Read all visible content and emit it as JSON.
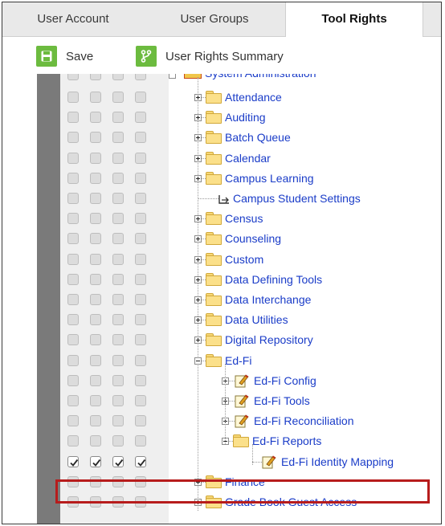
{
  "tabs": [
    {
      "label": "User Account",
      "active": false
    },
    {
      "label": "User Groups",
      "active": false
    },
    {
      "label": "Tool Rights",
      "active": true
    }
  ],
  "toolbar": {
    "save_label": "Save",
    "save_icon": "save-icon",
    "summary_label": "User Rights Summary",
    "summary_icon": "branch-icon",
    "accent_color": "#6cbb3f"
  },
  "tree": {
    "partial_label": "System Administration",
    "rows": [
      {
        "label": "Attendance",
        "type": "folder",
        "expander": "plus",
        "checks": [
          false,
          false,
          false,
          false
        ]
      },
      {
        "label": "Auditing",
        "type": "folder",
        "expander": "plus",
        "checks": [
          false,
          false,
          false,
          false
        ]
      },
      {
        "label": "Batch Queue",
        "type": "folder",
        "expander": "plus",
        "checks": [
          false,
          false,
          false,
          false
        ]
      },
      {
        "label": "Calendar",
        "type": "folder",
        "expander": "plus",
        "checks": [
          false,
          false,
          false,
          false
        ]
      },
      {
        "label": "Campus Learning",
        "type": "folder",
        "expander": "plus",
        "checks": [
          false,
          false,
          false,
          false
        ]
      },
      {
        "label": "Campus Student Settings",
        "type": "link",
        "expander": "none",
        "checks": [
          false,
          false,
          false,
          false
        ]
      },
      {
        "label": "Census",
        "type": "folder",
        "expander": "plus",
        "checks": [
          false,
          false,
          false,
          false
        ]
      },
      {
        "label": "Counseling",
        "type": "folder",
        "expander": "plus",
        "checks": [
          false,
          false,
          false,
          false
        ]
      },
      {
        "label": "Custom",
        "type": "folder",
        "expander": "plus",
        "checks": [
          false,
          false,
          false,
          false
        ]
      },
      {
        "label": "Data Defining Tools",
        "type": "folder",
        "expander": "plus",
        "checks": [
          false,
          false,
          false,
          false
        ]
      },
      {
        "label": "Data Interchange",
        "type": "folder",
        "expander": "plus",
        "checks": [
          false,
          false,
          false,
          false
        ]
      },
      {
        "label": "Data Utilities",
        "type": "folder",
        "expander": "plus",
        "checks": [
          false,
          false,
          false,
          false
        ]
      },
      {
        "label": "Digital Repository",
        "type": "folder",
        "expander": "plus",
        "checks": [
          false,
          false,
          false,
          false
        ]
      },
      {
        "label": "Ed-Fi",
        "type": "folder",
        "expander": "minus",
        "checks": [
          false,
          false,
          false,
          false
        ]
      },
      {
        "label": "Ed-Fi Config",
        "type": "tool",
        "expander": "plus",
        "checks": [
          false,
          false,
          false,
          false
        ]
      },
      {
        "label": "Ed-Fi Tools",
        "type": "tool",
        "expander": "plus",
        "checks": [
          false,
          false,
          false,
          false
        ]
      },
      {
        "label": "Ed-Fi Reconciliation",
        "type": "tool",
        "expander": "plus",
        "checks": [
          false,
          false,
          false,
          false
        ]
      },
      {
        "label": "Ed-Fi Reports",
        "type": "folder",
        "expander": "minus",
        "checks": [
          false,
          false,
          false,
          false
        ]
      },
      {
        "label": "Ed-Fi Identity Mapping",
        "type": "tool",
        "expander": "none",
        "checks": [
          true,
          true,
          true,
          true
        ],
        "highlighted": true
      },
      {
        "label": "Finance",
        "type": "folder",
        "expander": "plus",
        "checks": [
          false,
          false,
          false,
          false
        ]
      },
      {
        "label": "Grade Book Guest Access",
        "type": "folder",
        "expander": "plus",
        "checks": [
          false,
          false,
          false,
          false
        ]
      }
    ]
  },
  "colors": {
    "link": "#1a3cc8",
    "highlight_border": "#b71c1c",
    "checkbox_off": "#dcdcdc",
    "sidebar_dark": "#7a7a7a"
  }
}
